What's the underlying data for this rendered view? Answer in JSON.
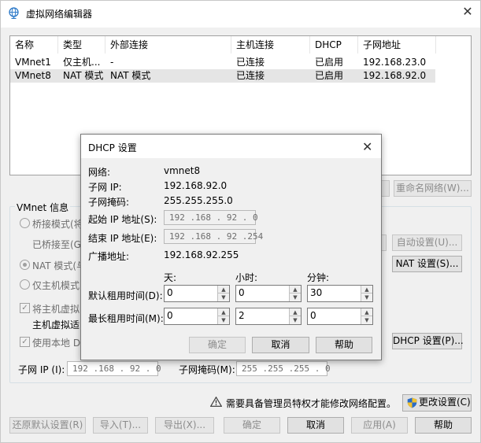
{
  "window": {
    "title": "虚拟网络编辑器",
    "close": "✕"
  },
  "table": {
    "headers": [
      "名称",
      "类型",
      "外部连接",
      "主机连接",
      "DHCP",
      "子网地址"
    ],
    "rows": [
      [
        "VMnet1",
        "仅主机...",
        "-",
        "已连接",
        "已启用",
        "192.168.23.0"
      ],
      [
        "VMnet8",
        "NAT 模式",
        "NAT 模式",
        "已连接",
        "已启用",
        "192.168.92.0"
      ]
    ]
  },
  "rename_btn": "重命名网络(W)...",
  "vmnet_info": {
    "legend": "VMnet 信息",
    "bridged_label": "桥接模式(将",
    "bridged_to_label": "已桥接至(G",
    "auto_settings_btn": "自动设置(U)...",
    "nat_label": "NAT 模式(与",
    "nat_settings_btn": "NAT 设置(S)...",
    "host_only_label": "仅主机模式(",
    "connect_host_label": "将主机虚拟",
    "host_virtual_label": "主机虚拟适",
    "use_dhcp_label": "使用本地 DH",
    "dhcp_settings_btn": "DHCP 设置(P)...",
    "subnet_ip_label": "子网 IP (I):",
    "subnet_ip_value": "192 .168 . 92 . 0",
    "subnet_mask_label": "子网掩码(M):",
    "subnet_mask_value": "255 .255 .255 . 0"
  },
  "admin_notice": "需要具备管理员特权才能修改网络配置。",
  "change_settings_btn": "更改设置(C)",
  "footer_buttons": {
    "restore": "还原默认设置(R)",
    "import": "导入(T)...",
    "export": "导出(X)...",
    "ok": "确定",
    "cancel": "取消",
    "apply": "应用(A)",
    "help": "帮助"
  },
  "dhcp_dialog": {
    "title": "DHCP 设置",
    "close": "✕",
    "network_label": "网络:",
    "network_value": "vmnet8",
    "subnet_ip_label": "子网 IP:",
    "subnet_ip_value": "192.168.92.0",
    "subnet_mask_label": "子网掩码:",
    "subnet_mask_value": "255.255.255.0",
    "start_ip_label": "起始 IP 地址(S):",
    "start_ip_value": "192 .168 . 92 . 0",
    "end_ip_label": "结束 IP 地址(E):",
    "end_ip_value": "192 .168 . 92 .254",
    "broadcast_label": "广播地址:",
    "broadcast_value": "192.168.92.255",
    "days_label": "天:",
    "hours_label": "小时:",
    "minutes_label": "分钟:",
    "default_lease_label": "默认租用时间(D):",
    "default_lease": {
      "days": "0",
      "hours": "0",
      "minutes": "30"
    },
    "max_lease_label": "最长租用时间(M):",
    "max_lease": {
      "days": "0",
      "hours": "2",
      "minutes": "0"
    },
    "ok_btn": "确定",
    "cancel_btn": "取消",
    "help_btn": "帮助"
  }
}
